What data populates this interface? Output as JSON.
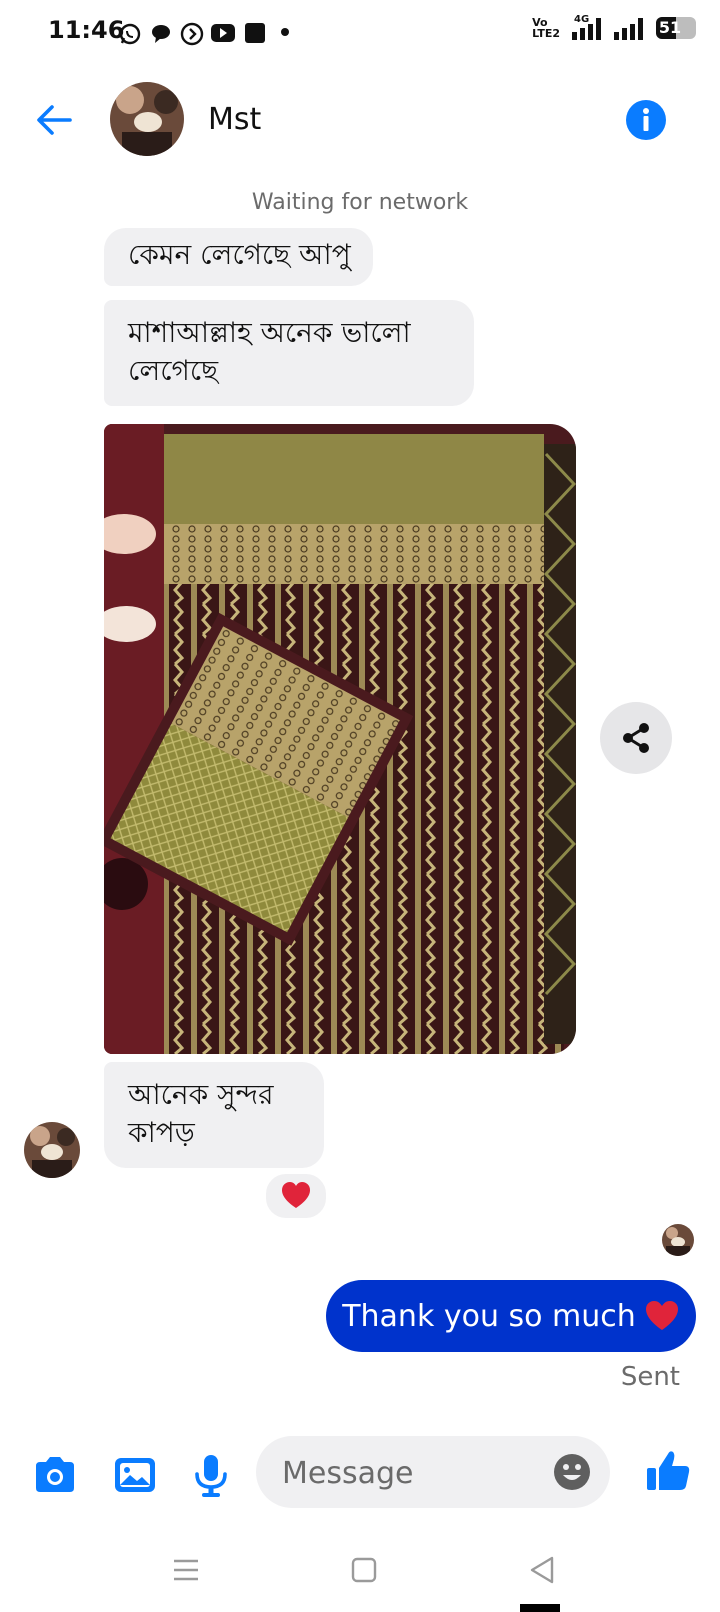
{
  "status_bar": {
    "time": "11:46",
    "net_top": "Vo",
    "net_bottom": "LTE2",
    "net_gen": "4G",
    "battery": "51"
  },
  "header": {
    "contact_name": "Mst"
  },
  "network_status": "Waiting for network",
  "messages": {
    "incoming_1": "কেমন লেগেছে আপু",
    "incoming_2": "মাশাআল্লাহ অনেক ভালো লেগেছে",
    "incoming_3": "আনেক সুন্দর কাপড়",
    "reaction": "❤️",
    "outgoing_1": "Thank you so much",
    "outgoing_emoji": "❤️",
    "outgoing_status": "Sent"
  },
  "composer": {
    "placeholder": "Message"
  },
  "colors": {
    "accent": "#0a7cff",
    "outgoing_bubble": "#0033cc",
    "incoming_bubble": "#f0f0f2",
    "heart": "#e0243a"
  },
  "icons": [
    "back-arrow-icon",
    "info-icon",
    "share-icon",
    "camera-icon",
    "gallery-icon",
    "microphone-icon",
    "emoji-icon",
    "thumbs-up-icon",
    "menu-icon",
    "home-icon",
    "back-icon"
  ]
}
